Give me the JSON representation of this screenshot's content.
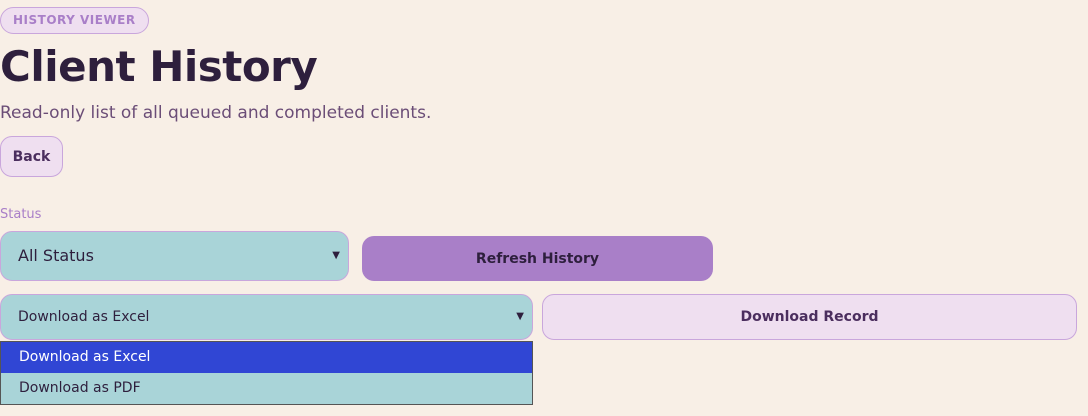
{
  "header": {
    "badge": "HISTORY VIEWER",
    "title": "Client History",
    "subtitle": "Read-only list of all queued and completed clients."
  },
  "actions": {
    "back_label": "Back",
    "refresh_label": "Refresh History",
    "download_label": "Download Record"
  },
  "filters": {
    "status_label": "Status",
    "status_selected": "All Status"
  },
  "download": {
    "selected": "Download as Excel",
    "options": [
      "Download as Excel",
      "Download as PDF"
    ]
  },
  "colors": {
    "background": "#f8efe6",
    "accent": "#a97fc8",
    "select_bg": "#a9d4d8",
    "soft_button": "#efdff0",
    "highlight": "#3046d4"
  },
  "icons": {
    "select_arrow": "chevron-down-icon"
  }
}
